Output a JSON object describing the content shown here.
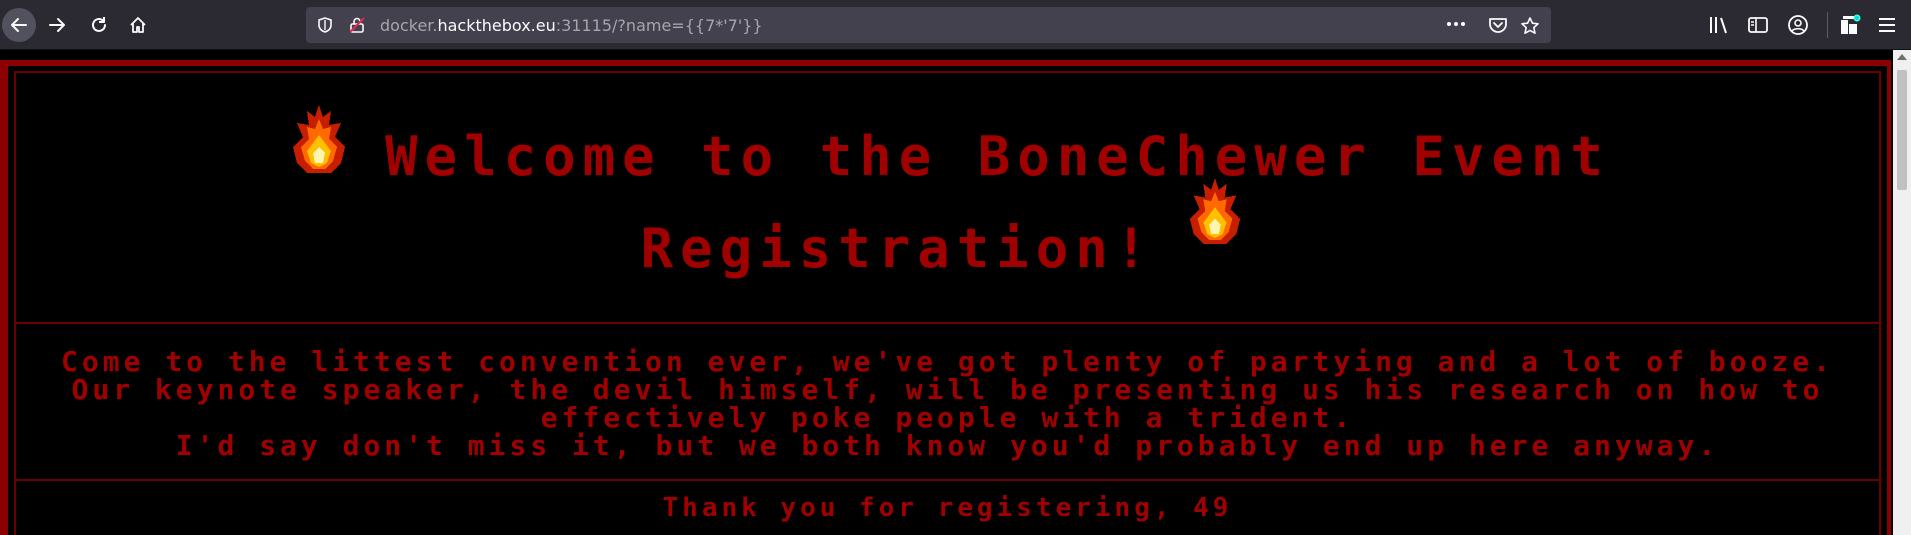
{
  "browser": {
    "url_prefix": "docker.",
    "url_host": "hackthebox.eu",
    "url_suffix": ":31115/?name={{7*'7'}}"
  },
  "page": {
    "title_line1": "Welcome to the BoneChewer Event",
    "title_line2": "Registration!",
    "desc_line1": "Come to the littest convention ever, we've got plenty of partying and a lot of booze.",
    "desc_line2": "Our keynote speaker, the devil himself, will be presenting us his research on how to effectively poke people with a trident.",
    "desc_line3": "I'd say don't miss it, but we both know you'd probably end up here anyway.",
    "thanks": "Thank you for registering, 49"
  },
  "colors": {
    "text_red": "#a00000",
    "border_red": "#8b0000",
    "background": "#000000",
    "toolbar": "#2b2a33"
  },
  "icons": [
    "back-arrow-icon",
    "forward-arrow-icon",
    "reload-icon",
    "home-icon",
    "shield-icon",
    "insecure-lock-icon",
    "more-icon",
    "pocket-icon",
    "star-icon",
    "library-icon",
    "sidebar-icon",
    "account-icon",
    "extensions-icon",
    "menu-icon",
    "fire-icon"
  ]
}
